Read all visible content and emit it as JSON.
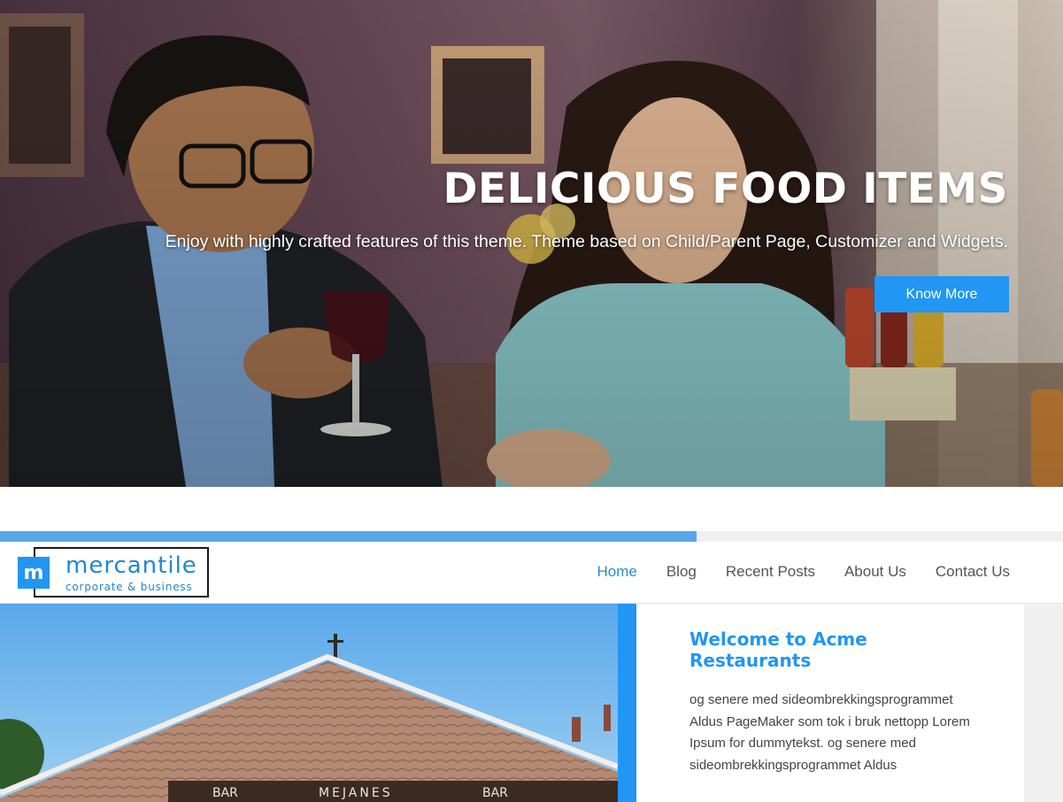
{
  "hero": {
    "title": "DELICIOUS FOOD ITEMS",
    "subtitle": "Enjoy with highly crafted features of this theme. Theme based on Child/Parent Page, Customizer and Widgets.",
    "button_label": "Know More"
  },
  "progress": {
    "value": 0.655
  },
  "logo": {
    "mark": "m",
    "name": "mercantile",
    "tagline": "corporate & business"
  },
  "nav": {
    "items": [
      {
        "label": "Home",
        "active": true
      },
      {
        "label": "Blog"
      },
      {
        "label": "Recent Posts"
      },
      {
        "label": "About Us"
      },
      {
        "label": "Contact Us"
      }
    ]
  },
  "photo": {
    "signs": [
      "BAR",
      "MEJANES",
      "BAR"
    ]
  },
  "welcome": {
    "title": "Welcome to Acme Restaurants",
    "body": "og senere med sideombrekkingsprogrammet Aldus PageMaker som tok i bruk nettopp Lorem Ipsum for dummytekst. og senere med sideombrekkingsprogrammet Aldus"
  },
  "colors": {
    "accent": "#2196f3",
    "nav_active": "#2a8ad6",
    "progress": "#5aa6e8"
  }
}
